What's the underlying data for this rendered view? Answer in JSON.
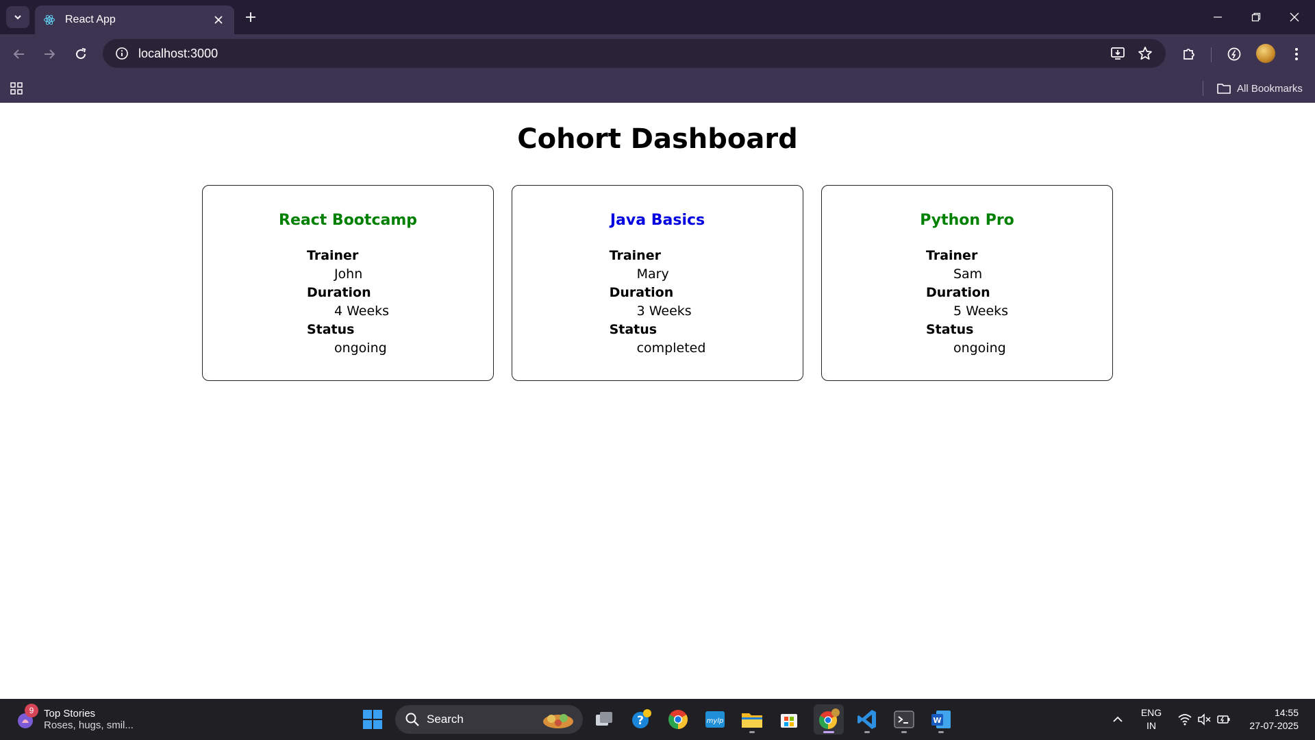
{
  "browser": {
    "tab_title": "React App",
    "url": "localhost:3000",
    "bookmarks_label": "All Bookmarks",
    "colors": {
      "frame": "#231d33",
      "toolbar": "#3d3452",
      "omnibox": "#2a2338"
    }
  },
  "page": {
    "title": "Cohort Dashboard",
    "cohorts": [
      {
        "name": "React Bootcamp",
        "trainer_label": "Trainer",
        "trainer": "John",
        "duration_label": "Duration",
        "duration": "4 Weeks",
        "status_label": "Status",
        "status": "ongoing",
        "name_color": "#008000"
      },
      {
        "name": "Java Basics",
        "trainer_label": "Trainer",
        "trainer": "Mary",
        "duration_label": "Duration",
        "duration": "3 Weeks",
        "status_label": "Status",
        "status": "completed",
        "name_color": "#0000e0"
      },
      {
        "name": "Python Pro",
        "trainer_label": "Trainer",
        "trainer": "Sam",
        "duration_label": "Duration",
        "duration": "5 Weeks",
        "status_label": "Status",
        "status": "ongoing",
        "name_color": "#008000"
      }
    ]
  },
  "taskbar": {
    "widget_badge": "9",
    "widget_title": "Top Stories",
    "widget_subtitle": "Roses, hugs, smil...",
    "search_label": "Search",
    "language_top": "ENG",
    "language_bottom": "IN",
    "time": "14:55",
    "date": "27-07-2025",
    "apps": [
      "start-icon",
      "task-view-icon",
      "help-icon",
      "chrome-icon",
      "mylp-icon",
      "file-explorer-icon",
      "store-icon",
      "chrome-dev-icon",
      "vscode-icon",
      "terminal-icon",
      "word-icon"
    ]
  }
}
